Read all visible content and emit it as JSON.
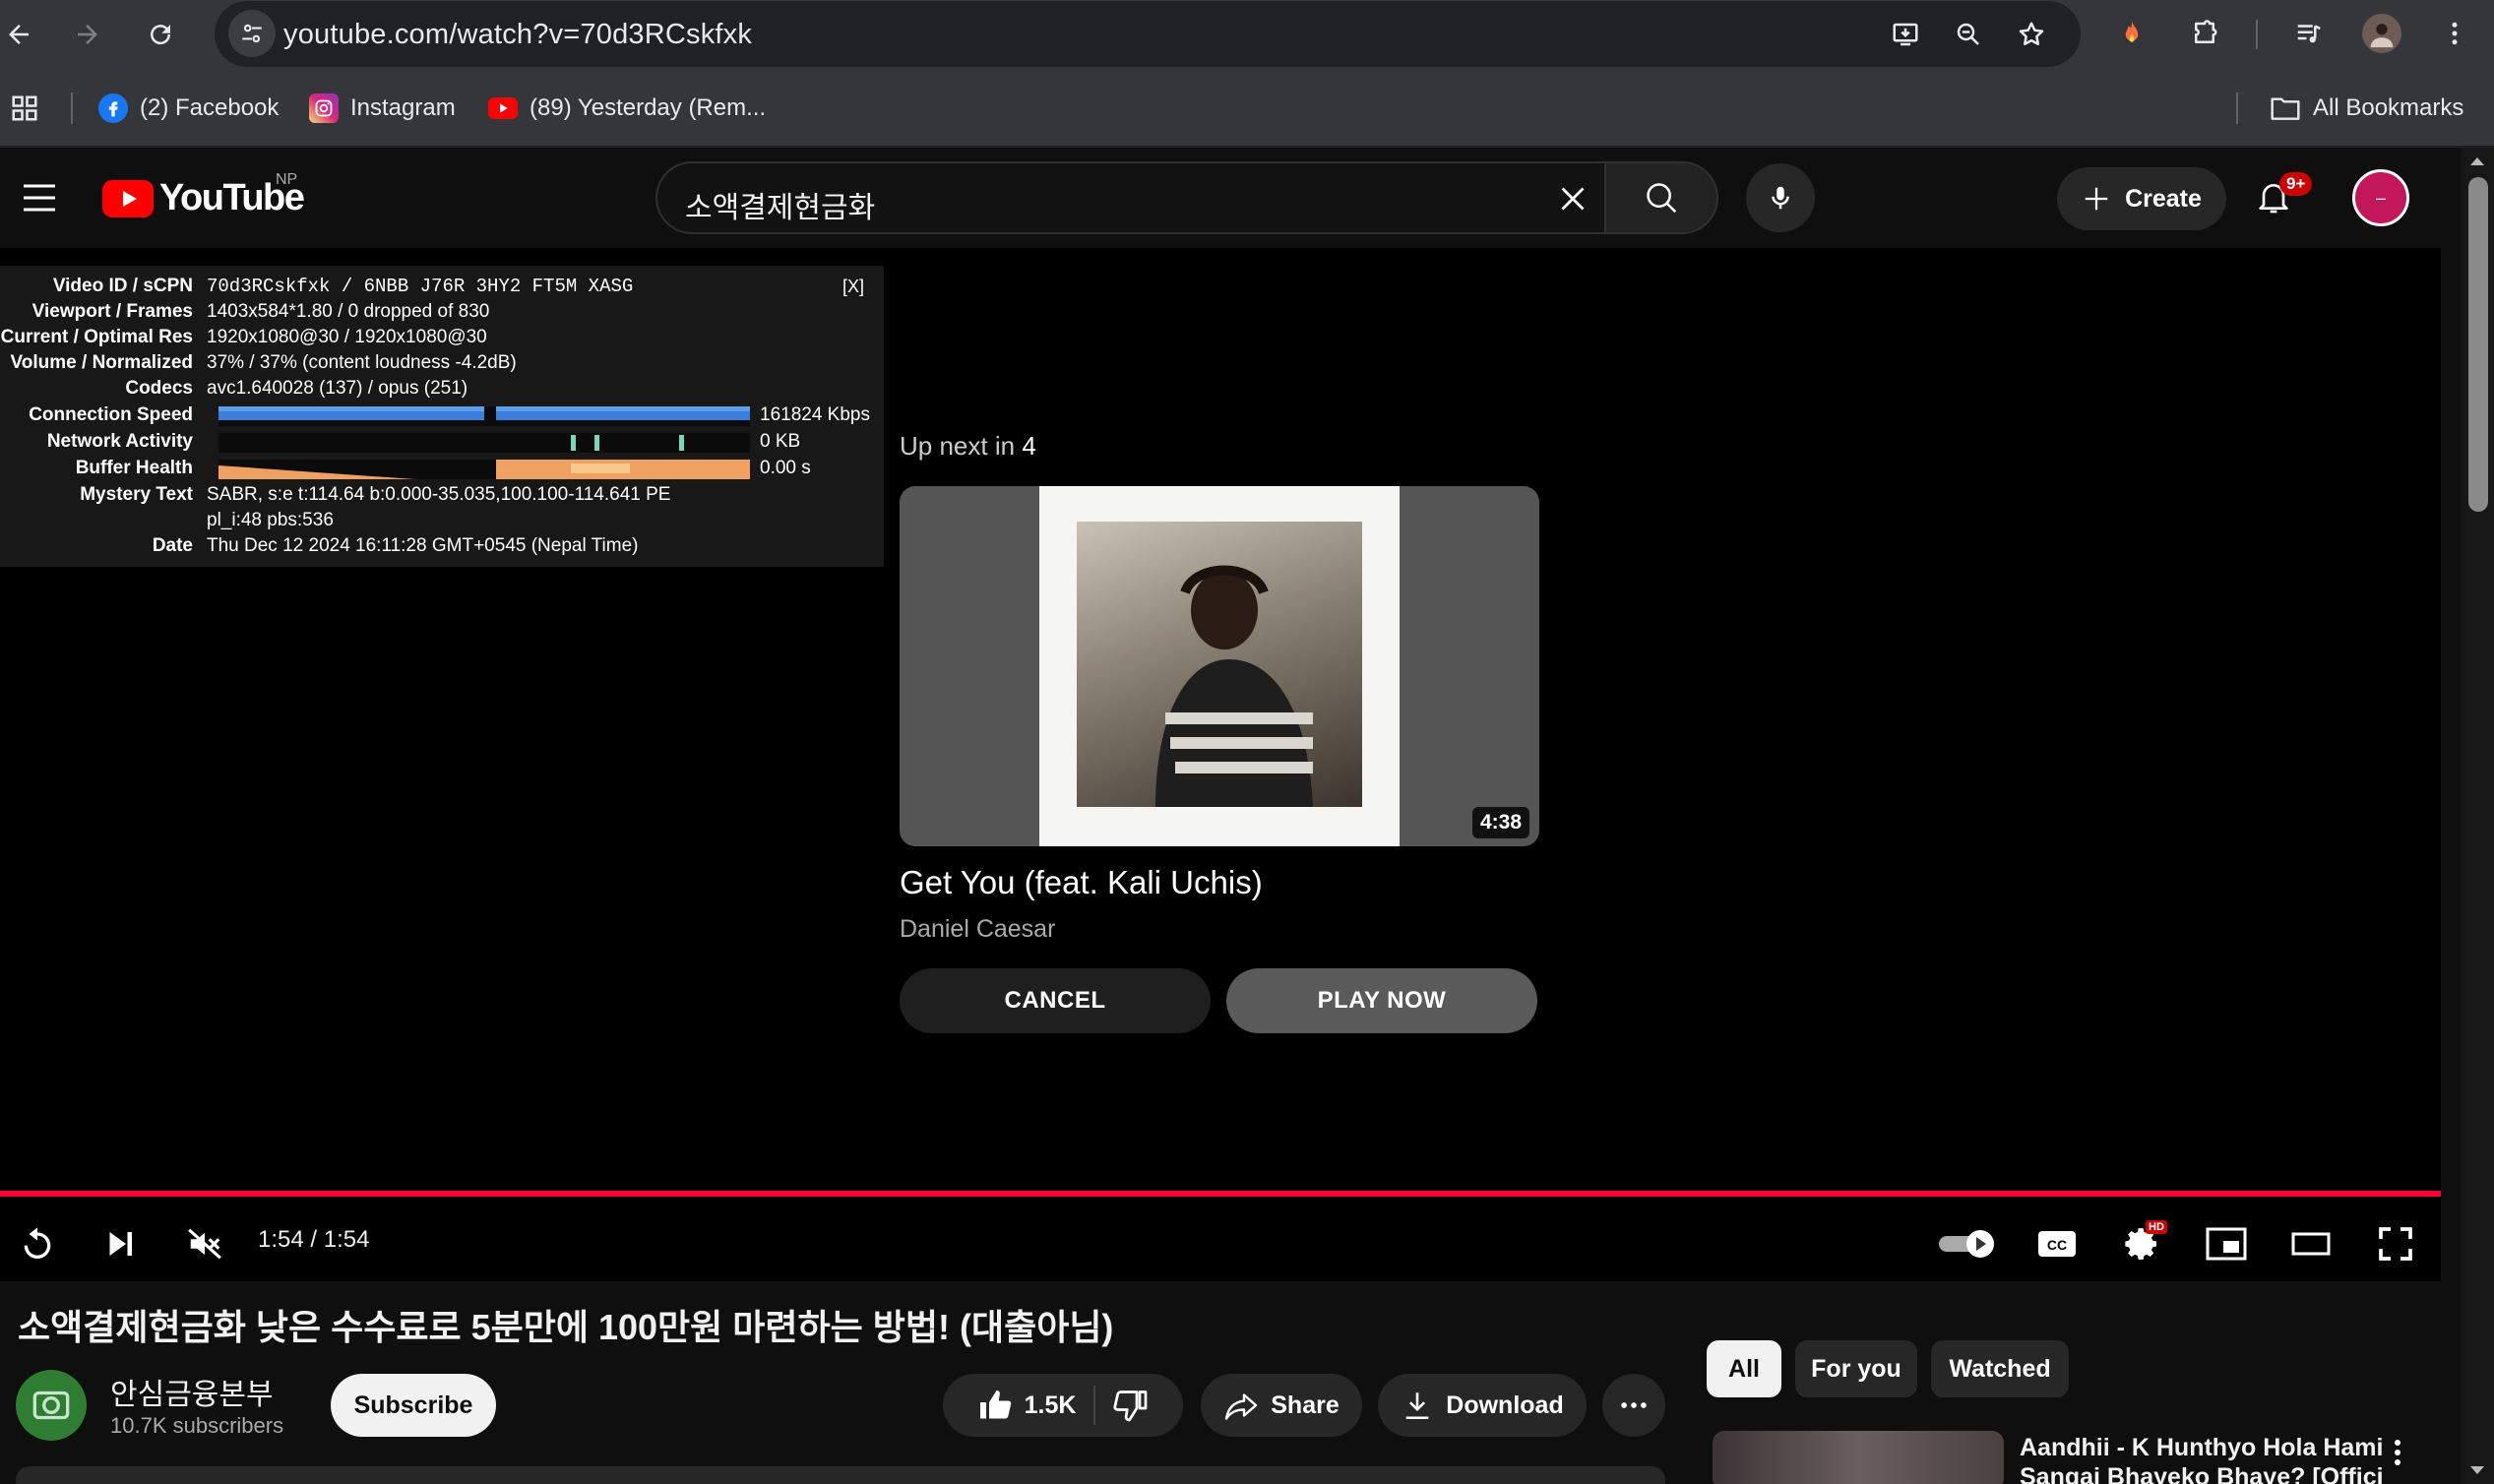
{
  "browser": {
    "url": "youtube.com/watch?v=70d3RCskfxk",
    "bookmarks": [
      {
        "label": "(2) Facebook",
        "icon": "facebook-icon"
      },
      {
        "label": "Instagram",
        "icon": "instagram-icon"
      },
      {
        "label": "(89) Yesterday (Rem...",
        "icon": "youtube-icon"
      }
    ],
    "all_bookmarks_label": "All Bookmarks"
  },
  "masthead": {
    "logo_text": "YouTube",
    "country_code": "NP",
    "search_query": "소액결제현금화",
    "create_label": "Create",
    "notification_badge": "9+",
    "avatar_initial": "–"
  },
  "stats_for_nerds": {
    "close_label": "[X]",
    "rows": [
      {
        "key": "Video ID / sCPN",
        "value": "70d3RCskfxk / 6NBB J76R 3HY2 FT5M XASG"
      },
      {
        "key": "Viewport / Frames",
        "value": "1403x584*1.80 / 0 dropped of 830"
      },
      {
        "key": "Current / Optimal Res",
        "value": "1920x1080@30 / 1920x1080@30"
      },
      {
        "key": "Volume / Normalized",
        "value": "37% / 37% (content loudness -4.2dB)"
      },
      {
        "key": "Codecs",
        "value": "avc1.640028 (137) / opus (251)"
      },
      {
        "key": "Connection Speed",
        "value": "161824 Kbps"
      },
      {
        "key": "Network Activity",
        "value": "0 KB"
      },
      {
        "key": "Buffer Health",
        "value": "0.00 s"
      },
      {
        "key": "Mystery Text",
        "value": "SABR, s:e t:114.64 b:0.000-35.035,100.100-114.641 PE"
      },
      {
        "key": "",
        "value": "pl_i:48 pbs:536"
      },
      {
        "key": "Date",
        "value": "Thu Dec 12 2024 16:11:28 GMT+0545 (Nepal Time)"
      }
    ]
  },
  "up_next": {
    "label": "Up next in",
    "countdown": "4",
    "duration": "4:38",
    "title": "Get You (feat. Kali Uchis)",
    "channel": "Daniel Caesar",
    "cancel_label": "CANCEL",
    "play_now_label": "PLAY NOW"
  },
  "player": {
    "time": "1:54 / 1:54",
    "progress_fraction": 1.0,
    "settings_badge": "HD",
    "accent": "#ff0033"
  },
  "video": {
    "title": "소액결제현금화 낮은 수수료로 5분만에 100만원 마련하는 방법! (대출아님)",
    "channel_name": "안심금융본부",
    "subscribers": "10.7K subscribers",
    "subscribe_label": "Subscribe",
    "likes": "1.5K",
    "share_label": "Share",
    "download_label": "Download"
  },
  "sidebar": {
    "chips": [
      "All",
      "For you",
      "Watched"
    ],
    "recommendation_title": "Aandhii - K Hunthyo Hola Hami Sangai Bhayeko Bhaye? [Offici"
  }
}
